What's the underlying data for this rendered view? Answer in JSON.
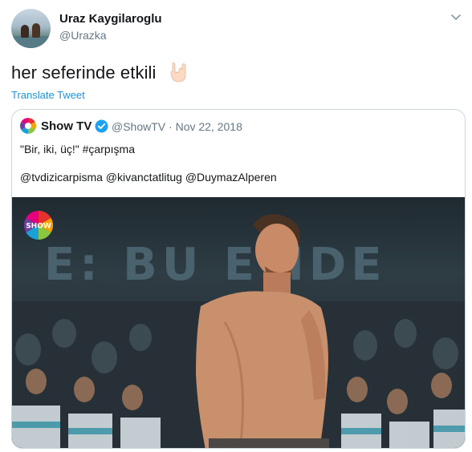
{
  "author": {
    "name": "Uraz Kaygilaroglu",
    "handle": "@Urazka"
  },
  "tweet": {
    "text": "her seferinde etkili",
    "translate_label": "Translate Tweet"
  },
  "quoted": {
    "name": "Show TV",
    "handle": "@ShowTV",
    "separator": "·",
    "date": "Nov 22, 2018",
    "line1": "\"Bir, iki, üç!\"  #çarpışma",
    "line2": "@tvdizicarpisma @kivanctatlitug @DuymazAlperen"
  },
  "media": {
    "background_text": "E: BU  EMDE",
    "logo_label": "SHOW"
  },
  "colors": {
    "link": "#1b95e0",
    "secondary": "#657786",
    "border": "#ccd6dd",
    "verified": "#1da1f2"
  }
}
